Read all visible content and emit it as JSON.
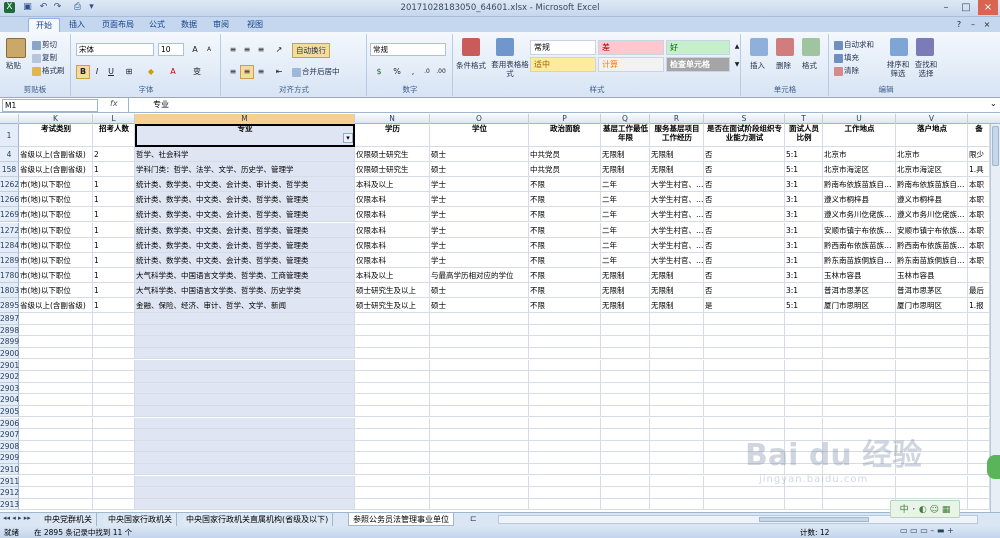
{
  "window": {
    "title": "20171028183050_64601.xlsx - Microsoft Excel"
  },
  "ribbon_tabs": [
    "开始",
    "插入",
    "页面布局",
    "公式",
    "数据",
    "审阅",
    "视图"
  ],
  "clipboard": {
    "paste": "粘贴",
    "cut": "剪切",
    "copy": "复制",
    "format_painter": "格式刷",
    "label": "剪贴板"
  },
  "font": {
    "name": "宋体",
    "size": "10",
    "label": "字体"
  },
  "alignment": {
    "wrap": "自动换行",
    "merge": "合并后居中",
    "label": "对齐方式"
  },
  "number": {
    "format": "常规",
    "label": "数字"
  },
  "styles": {
    "conditional": "条件格式",
    "table": "套用表格格式",
    "cell_styles": "单元格样式",
    "items": [
      {
        "name": "常规",
        "bg": "#ffffff",
        "fg": "#000000"
      },
      {
        "name": "差",
        "bg": "#ffc7ce",
        "fg": "#9c0006"
      },
      {
        "name": "好",
        "bg": "#c6efce",
        "fg": "#006100"
      },
      {
        "name": "适中",
        "bg": "#ffeb9c",
        "fg": "#9c6500"
      },
      {
        "name": "计算",
        "bg": "#f2f2f2",
        "fg": "#fa7d00"
      },
      {
        "name": "检查单元格",
        "bg": "#a5a5a5",
        "fg": "#ffffff"
      }
    ],
    "label": "样式"
  },
  "cells_group": {
    "insert": "插入",
    "delete": "删除",
    "format": "格式",
    "label": "单元格"
  },
  "editing": {
    "autosum": "自动求和",
    "fill": "填充",
    "clear": "清除",
    "sort": "排序和筛选",
    "find": "查找和选择",
    "label": "编辑"
  },
  "formula_bar": {
    "name_box": "M1",
    "fx": "fx",
    "content": "专业"
  },
  "columns": [
    "K",
    "L",
    "M",
    "N",
    "O",
    "P",
    "Q",
    "R",
    "S",
    "T",
    "U",
    "V"
  ],
  "header_row": {
    "row_num": "1",
    "cells": [
      "考试类别",
      "招考人数",
      "专业",
      "学历",
      "学位",
      "政治面貌",
      "基层工作最低年限",
      "服务基层项目工作经历",
      "是否在面试阶段组织专业能力测试",
      "面试人员比例",
      "工作地点",
      "落户地点",
      "备"
    ]
  },
  "rows": [
    {
      "num": "4",
      "cells": [
        "省级以上(含副省级)",
        "2",
        "哲学、社会科学",
        "仅限硕士研究生",
        "硕士",
        "中共党员",
        "无限制",
        "无限制",
        "否",
        "5:1",
        "北京市",
        "北京市",
        "限少"
      ]
    },
    {
      "num": "158",
      "cells": [
        "省级以上(含副省级)",
        "1",
        "学科门类：哲学、法学、文学、历史学、管理学",
        "仅限硕士研究生",
        "硕士",
        "中共党员",
        "无限制",
        "无限制",
        "否",
        "5:1",
        "北京市海淀区",
        "北京市海淀区",
        "1.具"
      ]
    },
    {
      "num": "1262",
      "cells": [
        "市(地)以下职位",
        "1",
        "统计类、数学类、中文类、会计类、审计类、哲学类",
        "本科及以上",
        "学士",
        "不限",
        "二年",
        "大学生村官、…",
        "否",
        "3:1",
        "黔南布依族苗族自…",
        "黔南布依族苗族自…",
        "本职"
      ]
    },
    {
      "num": "1266",
      "cells": [
        "市(地)以下职位",
        "1",
        "统计类、数学类、中文类、会计类、哲学类、管理类",
        "仅限本科",
        "学士",
        "不限",
        "二年",
        "大学生村官、…",
        "否",
        "3:1",
        "遵义市桐梓县",
        "遵义市桐梓县",
        "本职"
      ]
    },
    {
      "num": "1269",
      "cells": [
        "市(地)以下职位",
        "1",
        "统计类、数学类、中文类、会计类、哲学类、管理类",
        "仅限本科",
        "学士",
        "不限",
        "二年",
        "大学生村官、…",
        "否",
        "3:1",
        "遵义市务川仡佬族…",
        "遵义市务川仡佬族…",
        "本职"
      ]
    },
    {
      "num": "1272",
      "cells": [
        "市(地)以下职位",
        "1",
        "统计类、数学类、中文类、会计类、哲学类、管理类",
        "仅限本科",
        "学士",
        "不限",
        "二年",
        "大学生村官、…",
        "否",
        "3:1",
        "安顺市镇宁布依族…",
        "安顺市镇宁布依族…",
        "本职"
      ]
    },
    {
      "num": "1284",
      "cells": [
        "市(地)以下职位",
        "1",
        "统计类、数学类、中文类、会计类、哲学类、管理类",
        "仅限本科",
        "学士",
        "不限",
        "二年",
        "大学生村官、…",
        "否",
        "3:1",
        "黔西南布依族苗族…",
        "黔西南布依族苗族…",
        "本职"
      ]
    },
    {
      "num": "1289",
      "cells": [
        "市(地)以下职位",
        "1",
        "统计类、数学类、中文类、会计类、哲学类、管理类",
        "仅限本科",
        "学士",
        "不限",
        "二年",
        "大学生村官、…",
        "否",
        "3:1",
        "黔东南苗族侗族自…",
        "黔东南苗族侗族自…",
        "本职"
      ]
    },
    {
      "num": "1780",
      "cells": [
        "市(地)以下职位",
        "1",
        "大气科学类、中国语言文学类、哲学类、工商管理类",
        "本科及以上",
        "与最高学历相对应的学位",
        "不限",
        "无限制",
        "无限制",
        "否",
        "3:1",
        "玉林市容县",
        "玉林市容县",
        ""
      ]
    },
    {
      "num": "1803",
      "cells": [
        "市(地)以下职位",
        "1",
        "大气科学类、中国语言文学类、哲学类、历史学类",
        "硕士研究生及以上",
        "硕士",
        "不限",
        "无限制",
        "无限制",
        "否",
        "3:1",
        "普洱市思茅区",
        "普洱市思茅区",
        "最后"
      ]
    },
    {
      "num": "2895",
      "cells": [
        "省级以上(含副省级)",
        "1",
        "金融、保险、经济、审计、哲学、文学、新闻",
        "硕士研究生及以上",
        "硕士",
        "不限",
        "无限制",
        "无限制",
        "是",
        "5:1",
        "厦门市思明区",
        "厦门市思明区",
        "1.报"
      ]
    }
  ],
  "empty_rows": [
    "2897",
    "2898",
    "2899",
    "2900",
    "2901",
    "2902",
    "2903",
    "2904",
    "2905",
    "2906",
    "2907",
    "2908",
    "2909",
    "2910",
    "2911",
    "2912",
    "2913",
    "2914",
    "2915",
    "2916"
  ],
  "sheet_tabs": [
    "中央党群机关",
    "中央国家行政机关",
    "中央国家行政机关直属机构(省级及以下)",
    "参照公务员法管理事业单位"
  ],
  "status": {
    "ready": "就绪",
    "found": "在 2895 条记录中找到 11 个",
    "count": "计数: 12"
  },
  "watermark": {
    "brand": "Bai du 经验",
    "url": "jingyan.baidu.com"
  }
}
